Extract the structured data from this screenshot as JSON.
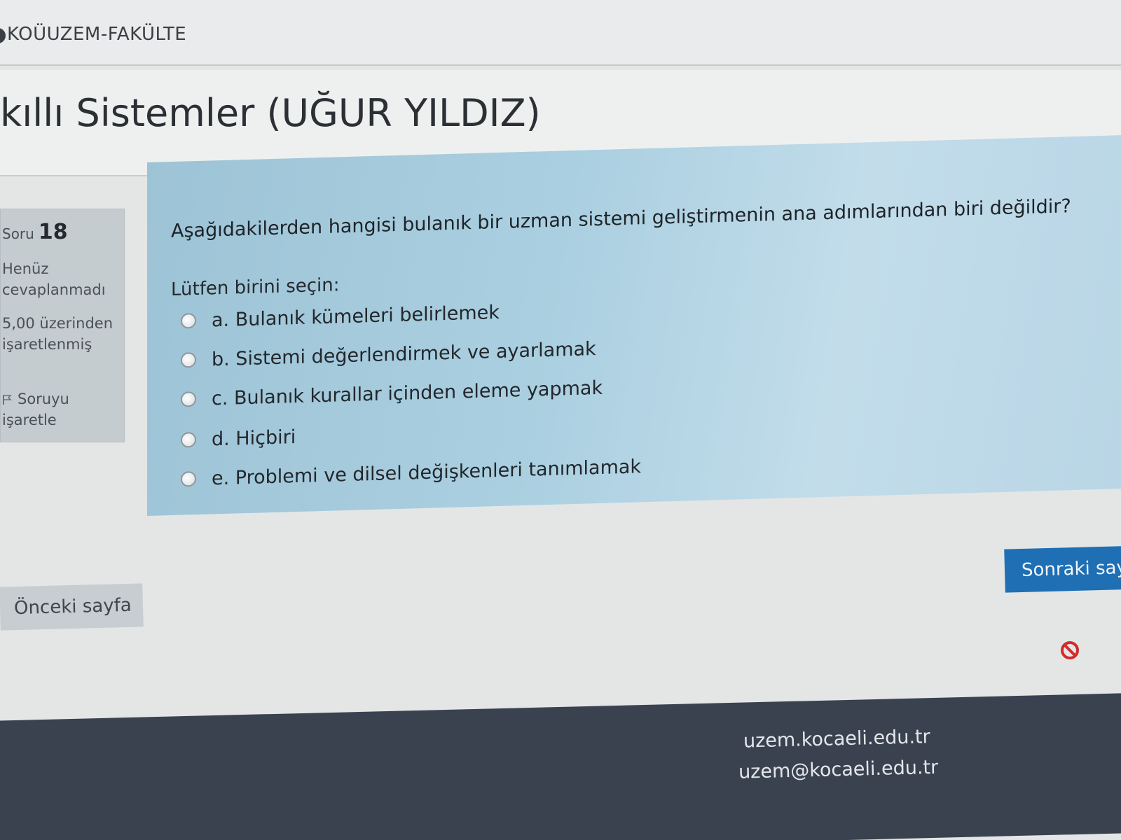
{
  "navbar": {
    "brand": "KOÜUZEM-FAKÜLTE"
  },
  "course": {
    "title": "kıllı Sistemler (UĞUR YILDIZ)"
  },
  "question_info": {
    "label": "Soru",
    "number": "18",
    "state": "Henüz cevaplanmadı",
    "grade": "5,00 üzerinden işaretlenmiş",
    "flag_label": "Soruyu işaretle"
  },
  "question": {
    "text": "Aşağıdakilerden hangisi bulanık bir uzman sistemi geliştirmenin ana adımlarından biri değildir?",
    "prompt": "Lütfen birini seçin:",
    "options": [
      {
        "label": "a. Bulanık kümeleri belirlemek"
      },
      {
        "label": "b. Sistemi değerlendirmek ve ayarlamak"
      },
      {
        "label": "c. Bulanık kurallar içinden eleme yapmak"
      },
      {
        "label": "d. Hiçbiri"
      },
      {
        "label": "e. Problemi ve dilsel değişkenleri tanımlamak"
      }
    ]
  },
  "navigation": {
    "next_label": "Sonraki sayfa",
    "prev_label": "Önceki sayfa"
  },
  "footer": {
    "url": "uzem.kocaeli.edu.tr",
    "email": "uzem@kocaeli.edu.tr"
  },
  "icons": {
    "flag": "flag-icon",
    "stop": "stop-icon",
    "radio": "radio-icon"
  },
  "colors": {
    "primary_button": "#1f6fb5",
    "question_bg": "#a9cfe0",
    "footer_bg": "#3a4250",
    "stop_icon": "#d42a2a"
  }
}
